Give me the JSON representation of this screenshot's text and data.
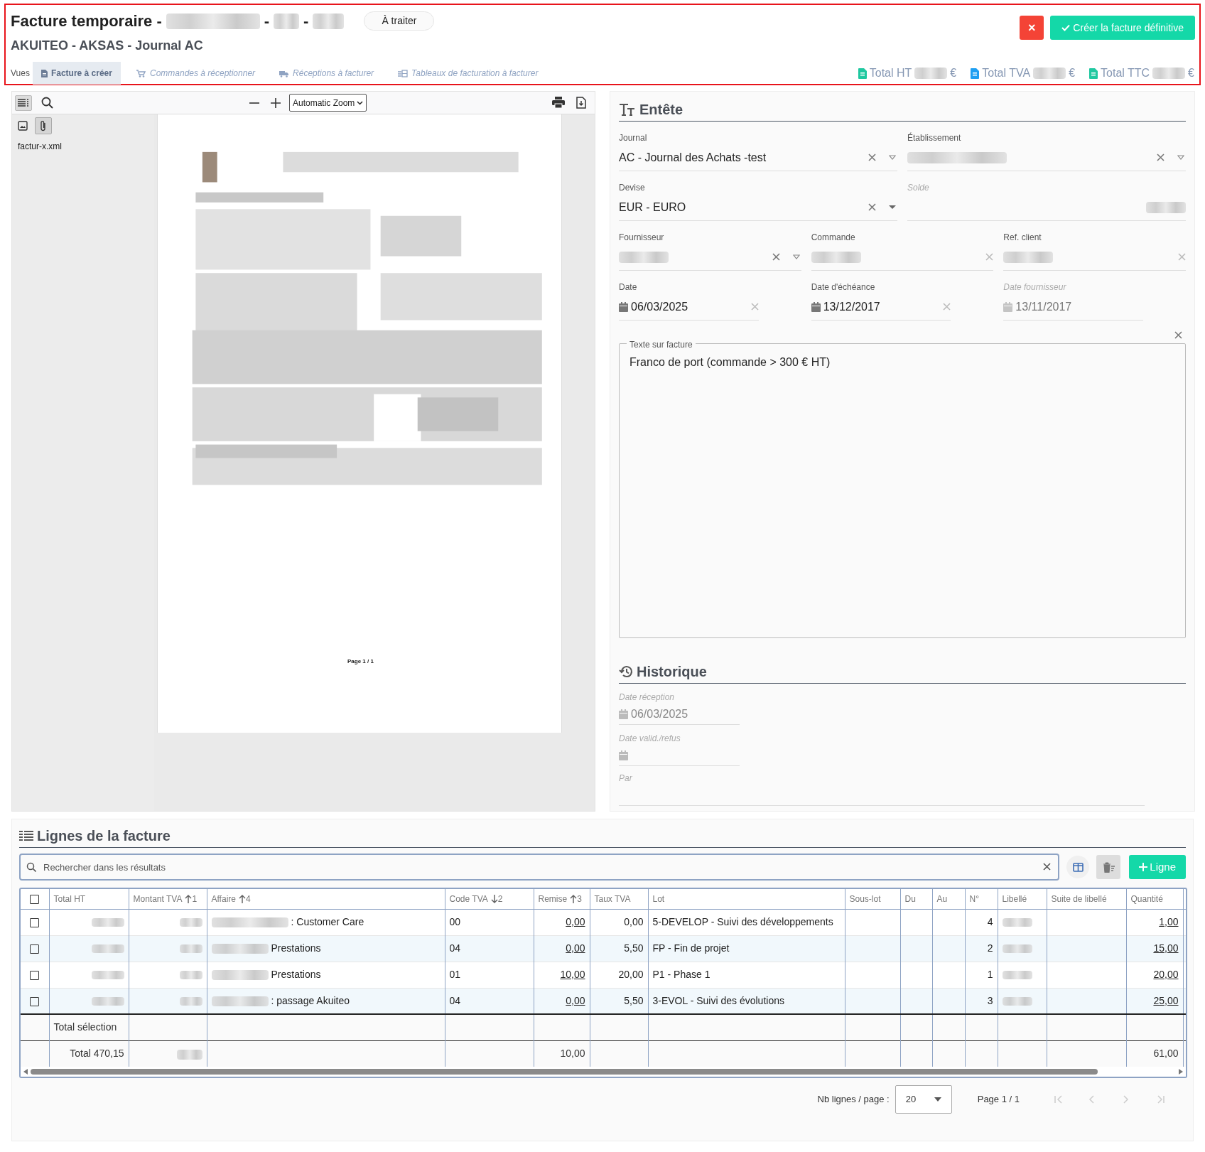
{
  "header": {
    "title_parts": [
      "Facture temporaire -",
      "-",
      "-"
    ],
    "status_badge": "À traiter",
    "subtitle": "AKUITEO - AKSAS - Journal AC",
    "cancel_button": "×",
    "create_button": "Créer la facture définitive",
    "views_label": "Vues",
    "views": [
      {
        "label": "Facture à créer",
        "selected": true,
        "kind": "invoice"
      },
      {
        "label": "Commandes à réceptionner",
        "selected": false,
        "kind": "cart"
      },
      {
        "label": "Réceptions à facturer",
        "selected": false,
        "kind": "receipt"
      },
      {
        "label": "Tableaux de facturation à facturer",
        "selected": false,
        "kind": "table"
      }
    ],
    "totals": [
      {
        "label": "Total HT",
        "currency": "€",
        "color": "#1fc8a0"
      },
      {
        "label": "Total TVA",
        "currency": "€",
        "color": "#1e9ff2"
      },
      {
        "label": "Total TTC",
        "currency": "€",
        "color": "#1fc8a0"
      }
    ]
  },
  "viewer": {
    "zoom": "Automatic Zoom",
    "attachment": "factur-x.xml",
    "page_label": "Page 1 / 1"
  },
  "entete": {
    "title": "Entête",
    "rows": [
      [
        {
          "label": "Journal",
          "value": "AC - Journal des Achats -test",
          "disabled": false,
          "kind": "select"
        },
        {
          "label": "Établissement",
          "redacted": true,
          "disabled": false,
          "kind": "select"
        }
      ],
      [
        {
          "label": "Devise",
          "value": "EUR - EURO",
          "disabled": false,
          "kind": "solid_select"
        },
        {
          "label": "Solde",
          "redacted": true,
          "disabled": true,
          "kind": "number"
        }
      ],
      [
        {
          "label": "Fournisseur",
          "redacted": true,
          "disabled": false,
          "kind": "select"
        },
        {
          "label": "Commande",
          "redacted": true,
          "disabled": false,
          "kind": "text"
        },
        {
          "label": "Ref. client",
          "redacted": true,
          "disabled": false,
          "kind": "text"
        }
      ],
      [
        {
          "label": "Date",
          "value": "06/03/2025",
          "disabled": false,
          "kind": "date"
        },
        {
          "label": "Date d'échéance",
          "value": "13/12/2017",
          "disabled": false,
          "kind": "date"
        },
        {
          "label": "Date fournisseur",
          "value": "13/11/2017",
          "disabled": true,
          "kind": "date"
        }
      ]
    ],
    "note_label": "Texte sur facture",
    "note_value": "Franco de port (commande > 300 € HT)"
  },
  "historique": {
    "title": "Historique",
    "fields": [
      {
        "label": "Date réception",
        "value": "06/03/2025",
        "kind": "date"
      },
      {
        "label": "Date valid./refus",
        "kind": "date"
      },
      {
        "label": "Par",
        "kind": "text"
      }
    ]
  },
  "lines": {
    "title": "Lignes de la facture",
    "search_placeholder": "Rechercher dans les résultats",
    "add_button": "Ligne",
    "all_checked": false,
    "columns": [
      {
        "label": "Total HT",
        "kind": "redacted"
      },
      {
        "label": "Montant TVA",
        "sorted": true,
        "descending": false,
        "order": "1",
        "kind": "redacted"
      },
      {
        "label": "Affaire",
        "sorted": true,
        "descending": false,
        "order": "4",
        "kind": "affaire"
      },
      {
        "label": "Code TVA",
        "sorted": true,
        "descending": true,
        "order": "2",
        "kind": "code_tva"
      },
      {
        "label": "Remise",
        "sorted": true,
        "descending": false,
        "order": "3",
        "kind": "remise"
      },
      {
        "label": "Taux TVA",
        "kind": "taux_tva"
      },
      {
        "label": "Lot",
        "kind": "lot"
      },
      {
        "label": "Sous-lot",
        "kind": "empty"
      },
      {
        "label": "Du",
        "kind": "empty"
      },
      {
        "label": "Au",
        "kind": "empty"
      },
      {
        "label": "N°",
        "kind": "no"
      },
      {
        "label": "Libellé",
        "kind": "redacted"
      },
      {
        "label": "Suite de libellé",
        "kind": "empty"
      },
      {
        "label": "Quantité",
        "kind": "quantite"
      }
    ],
    "rows": [
      {
        "checked": false,
        "affaire": ": Customer Care",
        "code_tva": "00",
        "remise": "0,00",
        "taux_tva": "0,00",
        "lot": "5-DEVELOP - Suivi des développements",
        "no": "4",
        "quantite": "1,00"
      },
      {
        "checked": false,
        "affaire": "Prestations",
        "code_tva": "04",
        "remise": "0,00",
        "taux_tva": "5,50",
        "lot": "FP - Fin de projet",
        "no": "2",
        "quantite": "15,00"
      },
      {
        "checked": false,
        "affaire": "Prestations",
        "code_tva": "01",
        "remise": "10,00",
        "taux_tva": "20,00",
        "lot": "P1 - Phase 1",
        "no": "1",
        "quantite": "20,00"
      },
      {
        "checked": false,
        "affaire": ": passage Akuiteo",
        "code_tva": "04",
        "remise": "0,00",
        "taux_tva": "5,50",
        "lot": "3-EVOL - Suivi des évolutions",
        "no": "3",
        "quantite": "25,00"
      }
    ],
    "selection_label": "Total sélection",
    "totals": {
      "total_ht": "Total 470,15",
      "remise": "10,00",
      "quantite": "61,00"
    },
    "page_size_label": "Nb lignes / page :",
    "page_size": "20",
    "page_info": "Page 1 / 1"
  }
}
